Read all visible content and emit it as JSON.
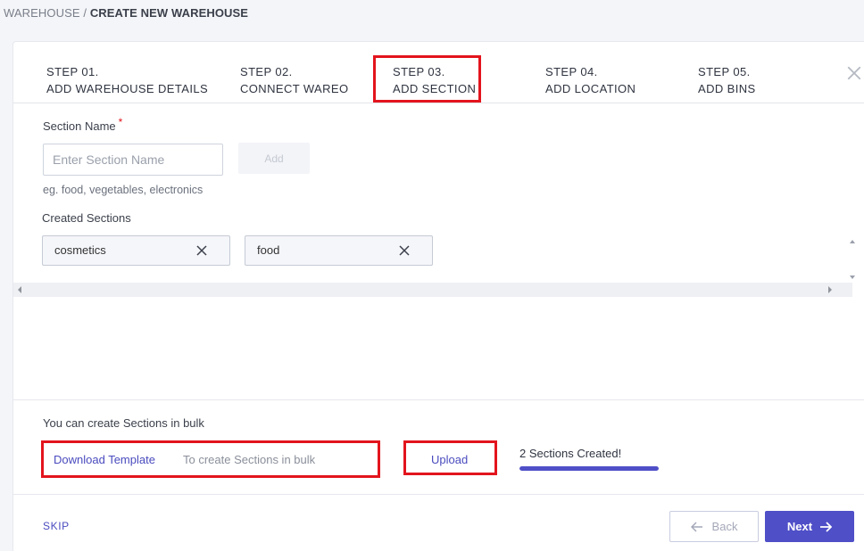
{
  "breadcrumb": {
    "parent": "WAREHOUSE",
    "separator": "/",
    "current": "CREATE NEW WAREHOUSE"
  },
  "steps": [
    {
      "number": "STEP 01.",
      "title": "ADD WAREHOUSE DETAILS"
    },
    {
      "number": "STEP 02.",
      "title": "CONNECT WAREO"
    },
    {
      "number": "STEP 03.",
      "title": "ADD SECTION"
    },
    {
      "number": "STEP 04.",
      "title": "ADD LOCATION"
    },
    {
      "number": "STEP 05.",
      "title": "ADD BINS"
    }
  ],
  "form": {
    "label": "Section Name",
    "required_mark": "*",
    "input_value": "",
    "input_placeholder": "Enter Section Name",
    "add_label": "Add",
    "hint": "eg. food, vegetables, electronics"
  },
  "created": {
    "label": "Created Sections",
    "chips": [
      "cosmetics",
      "food"
    ]
  },
  "bulk": {
    "label": "You can create Sections in bulk",
    "download_label": "Download Template",
    "download_hint": "To create Sections in bulk",
    "upload_label": "Upload",
    "status": "2 Sections Created!",
    "progress": 1.0
  },
  "footer": {
    "skip_label": "SKIP",
    "back_label": "Back",
    "next_label": "Next"
  },
  "colors": {
    "accent": "#4f4fc8",
    "highlight": "#e3141d"
  }
}
